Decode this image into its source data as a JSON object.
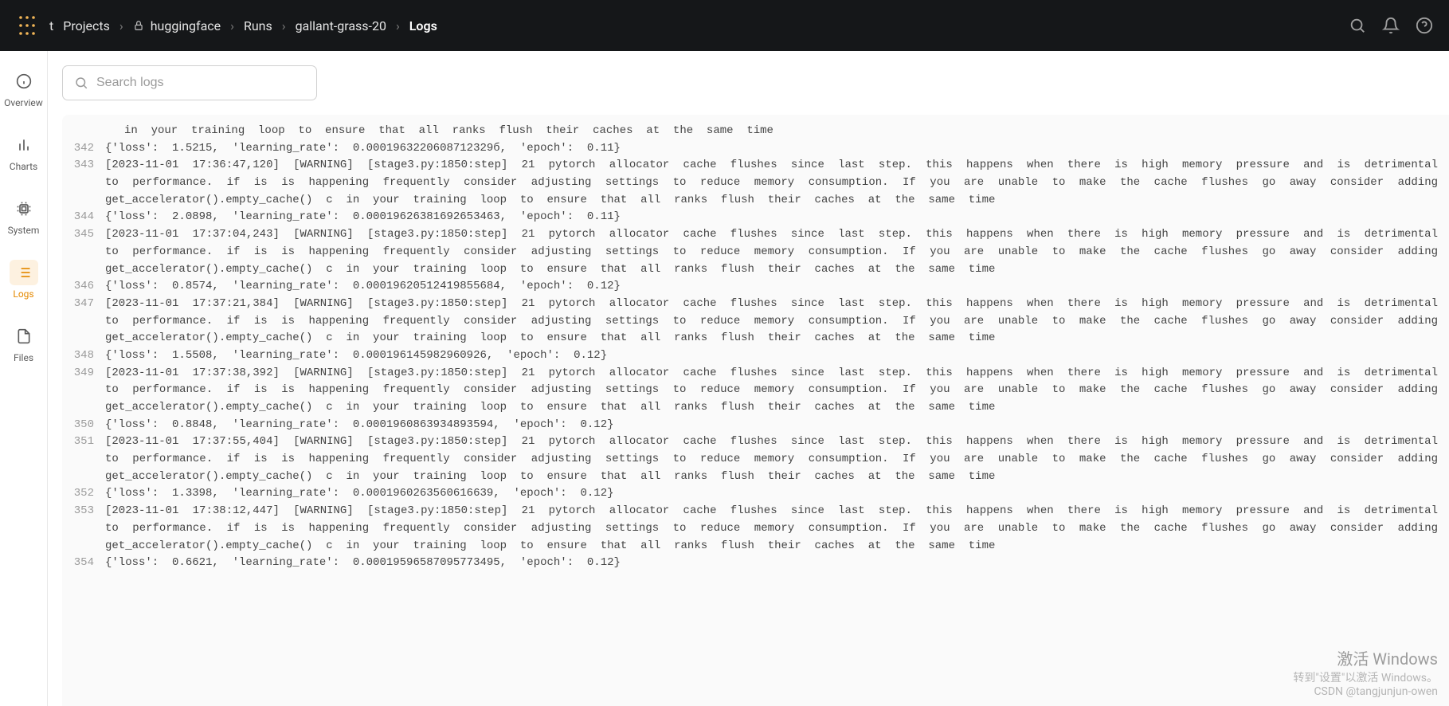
{
  "breadcrumb": {
    "org": "t",
    "projects": "Projects",
    "project": "huggingface",
    "runs": "Runs",
    "run": "gallant-grass-20",
    "current": "Logs"
  },
  "sidebar": {
    "overview": "Overview",
    "charts": "Charts",
    "system": "System",
    "logs": "Logs",
    "files": "Files"
  },
  "search": {
    "placeholder": "Search logs"
  },
  "partial_top": "in  your  training  loop  to  ensure  that  all  ranks  flush  their  caches  at  the  same  time",
  "logs": [
    {
      "n": "342",
      "t": "{'loss':  1.5215,  'learning_rate':  0.0001963220608712329б,  'epoch':  0.11}"
    },
    {
      "n": "343",
      "t": "[2023-11-01  17:36:47,120]  [WARNING]  [stage3.py:1850:step]  21  pytorch  allocator  cache  flushes  since  last  step.  this  happens  when  there  is  high  memory  pressure  and  is  detrimental  to  performance.  if  is  is  happening  frequently  consider  adjusting  settings  to  reduce  memory  consumption.  If  you  are  unable  to  make  the  cache  flushes  go  away  consider  adding  get_accelerator().empty_cache()  c  in  your  training  loop  to  ensure  that  all  ranks  flush  their  caches  at  the  same  time"
    },
    {
      "n": "344",
      "t": "{'loss':  2.0898,  'learning_rate':  0.00019626381692653463,  'epoch':  0.11}"
    },
    {
      "n": "345",
      "t": "[2023-11-01  17:37:04,243]  [WARNING]  [stage3.py:1850:step]  21  pytorch  allocator  cache  flushes  since  last  step.  this  happens  when  there  is  high  memory  pressure  and  is  detrimental  to  performance.  if  is  is  happening  frequently  consider  adjusting  settings  to  reduce  memory  consumption.  If  you  are  unable  to  make  the  cache  flushes  go  away  consider  adding  get_accelerator().empty_cache()  c  in  your  training  loop  to  ensure  that  all  ranks  flush  their  caches  at  the  same  time"
    },
    {
      "n": "346",
      "t": "{'loss':  0.8574,  'learning_rate':  0.00019620512419855684,  'epoch':  0.12}"
    },
    {
      "n": "347",
      "t": "[2023-11-01  17:37:21,384]  [WARNING]  [stage3.py:1850:step]  21  pytorch  allocator  cache  flushes  since  last  step.  this  happens  when  there  is  high  memory  pressure  and  is  detrimental  to  performance.  if  is  is  happening  frequently  consider  adjusting  settings  to  reduce  memory  consumption.  If  you  are  unable  to  make  the  cache  flushes  go  away  consider  adding  get_accelerator().empty_cache()  c  in  your  training  loop  to  ensure  that  all  ranks  flush  their  caches  at  the  same  time"
    },
    {
      "n": "348",
      "t": "{'loss':  1.5508,  'learning_rate':  0.000196145982960926,  'epoch':  0.12}"
    },
    {
      "n": "349",
      "t": "[2023-11-01  17:37:38,392]  [WARNING]  [stage3.py:1850:step]  21  pytorch  allocator  cache  flushes  since  last  step.  this  happens  when  there  is  high  memory  pressure  and  is  detrimental  to  performance.  if  is  is  happening  frequently  consider  adjusting  settings  to  reduce  memory  consumption.  If  you  are  unable  to  make  the  cache  flushes  go  away  consider  adding  get_accelerator().empty_cache()  c  in  your  training  loop  to  ensure  that  all  ranks  flush  their  caches  at  the  same  time"
    },
    {
      "n": "350",
      "t": "{'loss':  0.8848,  'learning_rate':  0.0001960863934893594,  'epoch':  0.12}"
    },
    {
      "n": "351",
      "t": "[2023-11-01  17:37:55,404]  [WARNING]  [stage3.py:1850:step]  21  pytorch  allocator  cache  flushes  since  last  step.  this  happens  when  there  is  high  memory  pressure  and  is  detrimental  to  performance.  if  is  is  happening  frequently  consider  adjusting  settings  to  reduce  memory  consumption.  If  you  are  unable  to  make  the  cache  flushes  go  away  consider  adding  get_accelerator().empty_cache()  c  in  your  training  loop  to  ensure  that  all  ranks  flush  their  caches  at  the  same  time"
    },
    {
      "n": "352",
      "t": "{'loss':  1.3398,  'learning_rate':  0.0001960263560616639,  'epoch':  0.12}"
    },
    {
      "n": "353",
      "t": "[2023-11-01  17:38:12,447]  [WARNING]  [stage3.py:1850:step]  21  pytorch  allocator  cache  flushes  since  last  step.  this  happens  when  there  is  high  memory  pressure  and  is  detrimental  to  performance.  if  is  is  happening  frequently  consider  adjusting  settings  to  reduce  memory  consumption.  If  you  are  unable  to  make  the  cache  flushes  go  away  consider  adding  get_accelerator().empty_cache()  c  in  your  training  loop  to  ensure  that  all  ranks  flush  their  caches  at  the  same  time"
    },
    {
      "n": "354",
      "t": "{'loss':  0.6621,  'learning_rate':  0.00019596587095773495,  'epoch':  0.12}"
    }
  ],
  "watermark": {
    "line1": "激活 Windows",
    "line2": "转到\"设置\"以激活 Windows。",
    "line3": "CSDN @tangjunjun-owen"
  }
}
